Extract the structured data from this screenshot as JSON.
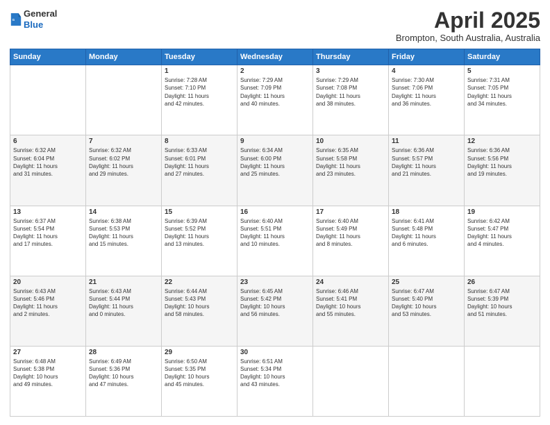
{
  "header": {
    "logo_line1": "General",
    "logo_line2": "Blue",
    "month_title": "April 2025",
    "subtitle": "Brompton, South Australia, Australia"
  },
  "days_of_week": [
    "Sunday",
    "Monday",
    "Tuesday",
    "Wednesday",
    "Thursday",
    "Friday",
    "Saturday"
  ],
  "weeks": [
    [
      {
        "day": "",
        "info": ""
      },
      {
        "day": "",
        "info": ""
      },
      {
        "day": "1",
        "info": "Sunrise: 7:28 AM\nSunset: 7:10 PM\nDaylight: 11 hours\nand 42 minutes."
      },
      {
        "day": "2",
        "info": "Sunrise: 7:29 AM\nSunset: 7:09 PM\nDaylight: 11 hours\nand 40 minutes."
      },
      {
        "day": "3",
        "info": "Sunrise: 7:29 AM\nSunset: 7:08 PM\nDaylight: 11 hours\nand 38 minutes."
      },
      {
        "day": "4",
        "info": "Sunrise: 7:30 AM\nSunset: 7:06 PM\nDaylight: 11 hours\nand 36 minutes."
      },
      {
        "day": "5",
        "info": "Sunrise: 7:31 AM\nSunset: 7:05 PM\nDaylight: 11 hours\nand 34 minutes."
      }
    ],
    [
      {
        "day": "6",
        "info": "Sunrise: 6:32 AM\nSunset: 6:04 PM\nDaylight: 11 hours\nand 31 minutes."
      },
      {
        "day": "7",
        "info": "Sunrise: 6:32 AM\nSunset: 6:02 PM\nDaylight: 11 hours\nand 29 minutes."
      },
      {
        "day": "8",
        "info": "Sunrise: 6:33 AM\nSunset: 6:01 PM\nDaylight: 11 hours\nand 27 minutes."
      },
      {
        "day": "9",
        "info": "Sunrise: 6:34 AM\nSunset: 6:00 PM\nDaylight: 11 hours\nand 25 minutes."
      },
      {
        "day": "10",
        "info": "Sunrise: 6:35 AM\nSunset: 5:58 PM\nDaylight: 11 hours\nand 23 minutes."
      },
      {
        "day": "11",
        "info": "Sunrise: 6:36 AM\nSunset: 5:57 PM\nDaylight: 11 hours\nand 21 minutes."
      },
      {
        "day": "12",
        "info": "Sunrise: 6:36 AM\nSunset: 5:56 PM\nDaylight: 11 hours\nand 19 minutes."
      }
    ],
    [
      {
        "day": "13",
        "info": "Sunrise: 6:37 AM\nSunset: 5:54 PM\nDaylight: 11 hours\nand 17 minutes."
      },
      {
        "day": "14",
        "info": "Sunrise: 6:38 AM\nSunset: 5:53 PM\nDaylight: 11 hours\nand 15 minutes."
      },
      {
        "day": "15",
        "info": "Sunrise: 6:39 AM\nSunset: 5:52 PM\nDaylight: 11 hours\nand 13 minutes."
      },
      {
        "day": "16",
        "info": "Sunrise: 6:40 AM\nSunset: 5:51 PM\nDaylight: 11 hours\nand 10 minutes."
      },
      {
        "day": "17",
        "info": "Sunrise: 6:40 AM\nSunset: 5:49 PM\nDaylight: 11 hours\nand 8 minutes."
      },
      {
        "day": "18",
        "info": "Sunrise: 6:41 AM\nSunset: 5:48 PM\nDaylight: 11 hours\nand 6 minutes."
      },
      {
        "day": "19",
        "info": "Sunrise: 6:42 AM\nSunset: 5:47 PM\nDaylight: 11 hours\nand 4 minutes."
      }
    ],
    [
      {
        "day": "20",
        "info": "Sunrise: 6:43 AM\nSunset: 5:46 PM\nDaylight: 11 hours\nand 2 minutes."
      },
      {
        "day": "21",
        "info": "Sunrise: 6:43 AM\nSunset: 5:44 PM\nDaylight: 11 hours\nand 0 minutes."
      },
      {
        "day": "22",
        "info": "Sunrise: 6:44 AM\nSunset: 5:43 PM\nDaylight: 10 hours\nand 58 minutes."
      },
      {
        "day": "23",
        "info": "Sunrise: 6:45 AM\nSunset: 5:42 PM\nDaylight: 10 hours\nand 56 minutes."
      },
      {
        "day": "24",
        "info": "Sunrise: 6:46 AM\nSunset: 5:41 PM\nDaylight: 10 hours\nand 55 minutes."
      },
      {
        "day": "25",
        "info": "Sunrise: 6:47 AM\nSunset: 5:40 PM\nDaylight: 10 hours\nand 53 minutes."
      },
      {
        "day": "26",
        "info": "Sunrise: 6:47 AM\nSunset: 5:39 PM\nDaylight: 10 hours\nand 51 minutes."
      }
    ],
    [
      {
        "day": "27",
        "info": "Sunrise: 6:48 AM\nSunset: 5:38 PM\nDaylight: 10 hours\nand 49 minutes."
      },
      {
        "day": "28",
        "info": "Sunrise: 6:49 AM\nSunset: 5:36 PM\nDaylight: 10 hours\nand 47 minutes."
      },
      {
        "day": "29",
        "info": "Sunrise: 6:50 AM\nSunset: 5:35 PM\nDaylight: 10 hours\nand 45 minutes."
      },
      {
        "day": "30",
        "info": "Sunrise: 6:51 AM\nSunset: 5:34 PM\nDaylight: 10 hours\nand 43 minutes."
      },
      {
        "day": "",
        "info": ""
      },
      {
        "day": "",
        "info": ""
      },
      {
        "day": "",
        "info": ""
      }
    ]
  ]
}
